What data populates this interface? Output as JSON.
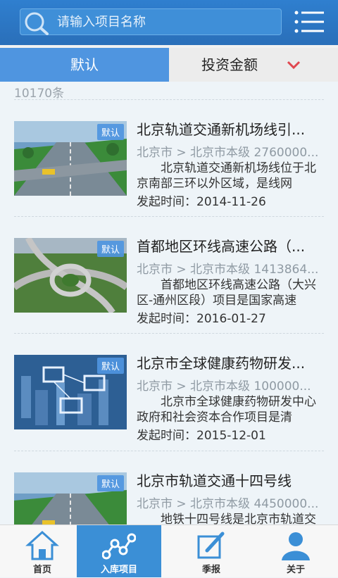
{
  "search": {
    "placeholder": "请输入项目名称"
  },
  "filters": {
    "default_label": "默认",
    "amount_label": "投资金额"
  },
  "count": "10170条",
  "items": [
    {
      "badge": "默认",
      "title": "北京轨道交通新机场线引...",
      "meta": "北京市 > 北京市本级  2760000...",
      "desc": "北京轨道交通新机场线位于北京南部三环以外区域，是线网",
      "date": "发起时间：2014-11-26"
    },
    {
      "badge": "默认",
      "title": "首都地区环线高速公路（...",
      "meta": "北京市 > 北京市本级  1413864...",
      "desc": "首都地区环线高速公路（大兴区-通州区段）项目是国家高速",
      "date": "发起时间：2016-01-27"
    },
    {
      "badge": "默认",
      "title": "北京市全球健康药物研发...",
      "meta": "北京市 > 北京市本级  100000...",
      "desc": "北京市全球健康药物研发中心政府和社会资本合作项目是清",
      "date": "发起时间：2015-12-01"
    },
    {
      "badge": "默认",
      "title": "北京市轨道交通十四号线",
      "meta": "北京市 > 北京市本级  4450000...",
      "desc": "地铁十四号线是北京市轨道交通线网中一条连接东北、西南",
      "date": ""
    }
  ],
  "nav": [
    {
      "label": "首页",
      "icon": "home-icon"
    },
    {
      "label": "入库项目",
      "icon": "project-network-icon"
    },
    {
      "label": "季报",
      "icon": "edit-report-icon"
    },
    {
      "label": "关于",
      "icon": "user-icon"
    }
  ],
  "colors": {
    "brand": "#2f7fcf",
    "active_tab": "#4f95e0",
    "active_nav": "#3b8fd6",
    "chevron": "#e0474f"
  }
}
